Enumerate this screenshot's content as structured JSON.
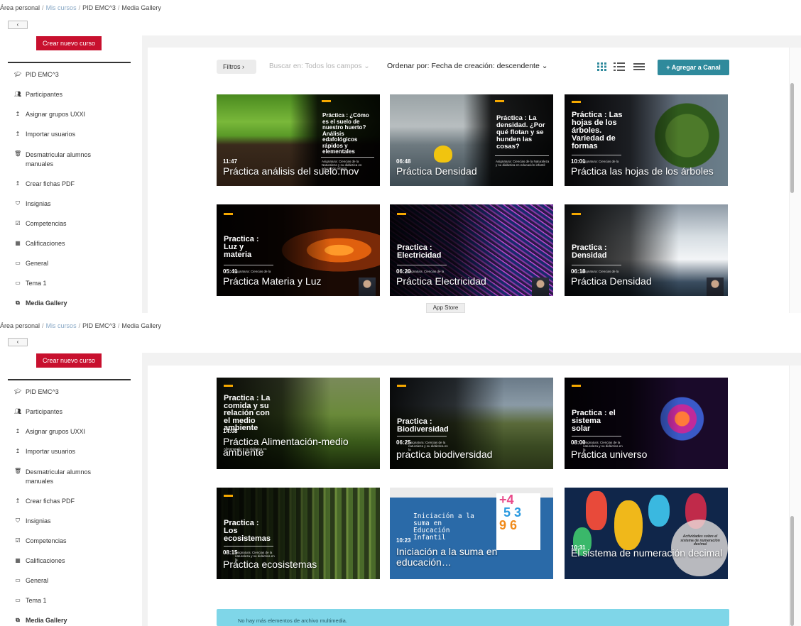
{
  "breadcrumb": {
    "home": "Área personal",
    "my_courses": "Mis cursos",
    "course": "PID EMC^3",
    "current": "Media Gallery",
    "separator": "/"
  },
  "back_button_label": "‹",
  "new_course_button": "Crear nuevo curso",
  "sidebar": [
    {
      "label": "PID EMC^3",
      "icon": "graduation-cap-icon"
    },
    {
      "label": "Participantes",
      "icon": "users-icon"
    },
    {
      "label": "Asignar grupos UXXI",
      "icon": "upload-icon"
    },
    {
      "label": "Importar usuarios",
      "icon": "upload-icon"
    },
    {
      "label": "Desmatricular alumnos manuales",
      "icon": "trash-icon"
    },
    {
      "label": "Crear fichas PDF",
      "icon": "upload-icon"
    },
    {
      "label": "Insignias",
      "icon": "shield-icon"
    },
    {
      "label": "Competencias",
      "icon": "check-square-icon"
    },
    {
      "label": "Calificaciones",
      "icon": "table-icon"
    },
    {
      "label": "General",
      "icon": "folder-icon"
    },
    {
      "label": "Tema 1",
      "icon": "folder-icon"
    },
    {
      "label": "Media Gallery",
      "icon": "media-gallery-icon"
    }
  ],
  "toolbar": {
    "filters": "Filtros ›",
    "search": "Buscar en: Todos los campos ⌄",
    "sort": "Ordenar por: Fecha de creación: descendente ⌄",
    "add_channel": "+  Agregar a Canal"
  },
  "app_store": "App Store",
  "no_more": "No hay más elementos de archivo multimedia.",
  "tiles_top": [
    {
      "overlay": [
        "Práctica : ¿Cómo",
        "es el suelo de",
        "nuestro huerto?",
        "Análisis",
        "edafológicos",
        "rápidos y",
        "elementales"
      ],
      "sub": "Asignatura: Ciencias de la Naturaleza y su didáctica en educación infantil",
      "duration": "11:47",
      "name": "Práctica análisis del suelo.mov"
    },
    {
      "overlay": [
        "Práctica : La",
        "densidad. ¿Por",
        "qué flotan y se",
        "hunden las",
        "cosas?"
      ],
      "sub": "Asignatura: Ciencias de la Naturaleza y su didáctica en educación infantil",
      "duration": "06:48",
      "name": "Práctica Densidad"
    },
    {
      "overlay": [
        "Práctica : Las",
        "hojas de los",
        "árboles.",
        "Variedad de",
        "formas"
      ],
      "sub": "Asignatura: Ciencias de la",
      "duration": "10:01",
      "name": "Práctica las hojas de los árboles"
    },
    {
      "overlay": [
        "Practica :",
        "Luz y",
        "materia"
      ],
      "sub": "Asignatura: Ciencias de la",
      "duration": "05:41",
      "name": "Práctica Materia y Luz"
    },
    {
      "overlay": [
        "Practica :",
        "Electricidad"
      ],
      "sub": "Asignatura: Ciencias de la",
      "duration": "06:20",
      "name": "Práctica Electricidad"
    },
    {
      "overlay": [
        "Practica :",
        "Densidad"
      ],
      "sub": "Asignatura: Ciencias de la",
      "duration": "06:18",
      "name": "Práctica Densidad"
    }
  ],
  "tiles_bottom": [
    {
      "overlay": [
        "Practica : La",
        "comida y su",
        "relación con",
        "el medio",
        "ambiente"
      ],
      "sub": "Alimentación y su didáctica en",
      "duration": "14:08",
      "name": "Práctica Alimentación-medio ambiente"
    },
    {
      "overlay": [
        "Practica :",
        "Biodiversidad"
      ],
      "sub": "Asignatura: Ciencias de la naturaleza y su didáctica en la",
      "duration": "06:25",
      "name": "practica biodiversidad"
    },
    {
      "overlay": [
        "Practica : el",
        "sistema",
        "solar"
      ],
      "sub": "Asignatura: Ciencias de la naturaleza y su didáctica en la",
      "duration": "08:00",
      "name": "Práctica universo"
    },
    {
      "overlay": [
        "Practica :",
        "Los",
        "ecosistemas"
      ],
      "sub": "Asignatura: Ciencias de la naturaleza y su didáctica en la",
      "duration": "08:15",
      "name": "Práctica ecosistemas"
    },
    {
      "overlay": [
        "Iniciación a la",
        "suma en",
        "Educación",
        "Infantil"
      ],
      "sub": "",
      "duration": "10:23",
      "name": "Iniciación a la suma en educación…"
    },
    {
      "overlay": [
        "Actividades sobre el",
        "sistema de numeración",
        "decimal"
      ],
      "sub": "",
      "duration": "10:31",
      "name": "El sistema de numeración decimal"
    }
  ],
  "colors": {
    "accent_red": "#c8102e",
    "teal": "#2f8a9c",
    "notice": "#7fd6e8",
    "bar_yellow": "#f5a800"
  }
}
